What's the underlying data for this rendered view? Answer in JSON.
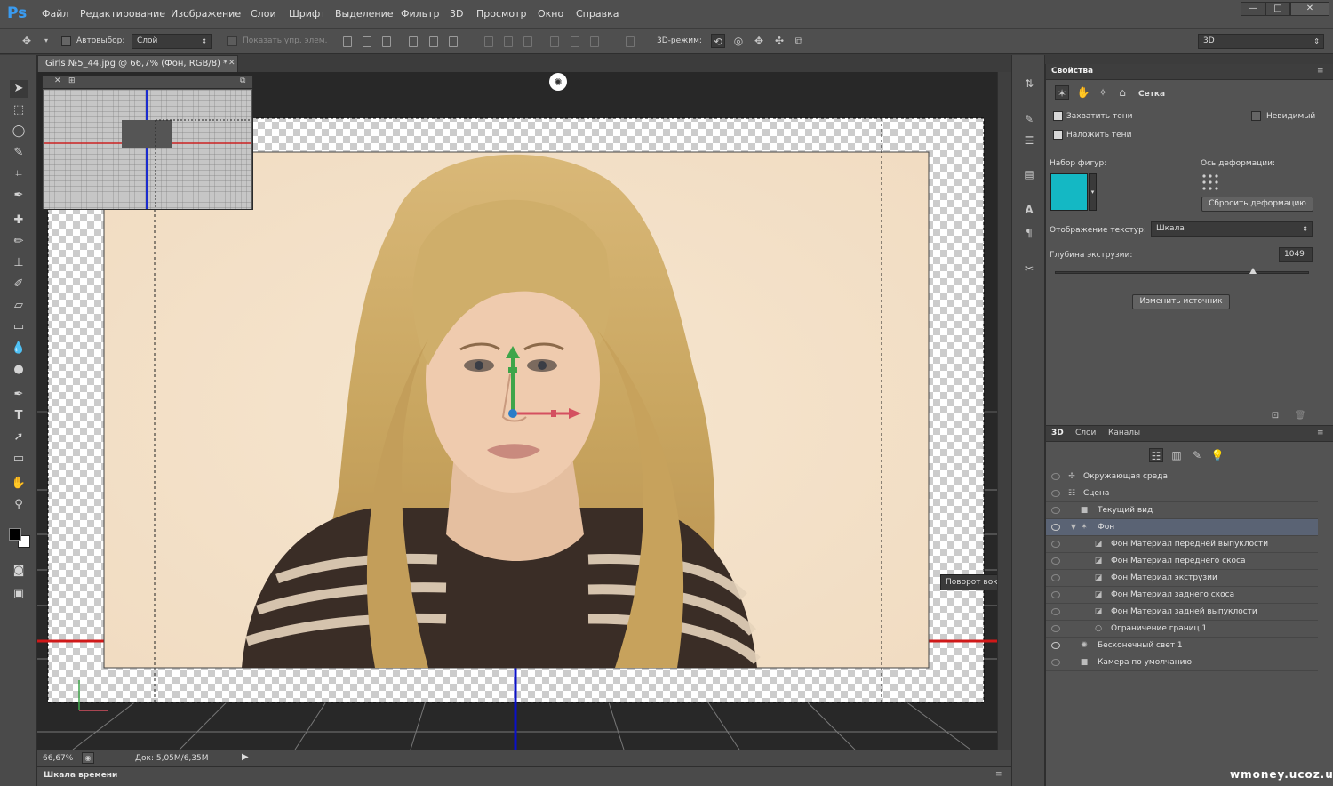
{
  "app": {
    "logo": "Ps"
  },
  "menu": [
    "Файл",
    "Редактирование",
    "Изображение",
    "Слои",
    "Шрифт",
    "Выделение",
    "Фильтр",
    "3D",
    "Просмотр",
    "Окно",
    "Справка"
  ],
  "window_controls": {
    "minimize": "—",
    "maximize": "□",
    "close": "✕"
  },
  "options": {
    "autoselect_label": "Автовыбор:",
    "layer_select": "Слой",
    "show_controls_label": "Показать упр. элем.",
    "mode3d_label": "3D-режим:",
    "workspace_select": "3D"
  },
  "document": {
    "tab_title": "Girls №5_44.jpg @ 66,7% (Фон, RGB/8) *",
    "zoom": "66,67%",
    "doc_size": "Док: 5,05M/6,35M",
    "tooltip": "Поворот вокруг оси Y"
  },
  "timeline": {
    "label": "Шкала времени"
  },
  "properties": {
    "tab": "Свойства",
    "mode_label": "Сетка",
    "capture_shadows": "Захватить тени",
    "cast_shadows": "Наложить тени",
    "invisible": "Невидимый",
    "shape_preset_label": "Набор фигур:",
    "shape_color": "#14b8c4",
    "deform_axis_label": "Ось деформации:",
    "reset_deform_button": "Сбросить деформацию",
    "texture_mapping_label": "Отображение текстур:",
    "texture_mapping_value": "Шкала",
    "extrusion_depth_label": "Глубина экструзии:",
    "extrusion_depth_value": "1049",
    "extrusion_slider_fraction": 0.78,
    "edit_source_button": "Изменить источник"
  },
  "layers_panel": {
    "tabs": [
      "3D",
      "Слои",
      "Каналы"
    ],
    "rows": [
      {
        "label": "Окружающая среда",
        "icon": "environment-icon"
      },
      {
        "label": "Сцена",
        "icon": "scene-icon"
      },
      {
        "label": "Текущий вид",
        "icon": "camera-icon"
      },
      {
        "label": "Фон",
        "icon": "mesh-icon"
      },
      {
        "label": "Фон Материал передней выпуклости",
        "icon": "material-icon"
      },
      {
        "label": "Фон Материал переднего скоса",
        "icon": "material-icon"
      },
      {
        "label": "Фон Материал экструзии",
        "icon": "material-icon"
      },
      {
        "label": "Фон Материал заднего скоса",
        "icon": "material-icon"
      },
      {
        "label": "Фон Материал задней выпуклости",
        "icon": "material-icon"
      },
      {
        "label": "Ограничение границ 1",
        "icon": "constraint-icon"
      },
      {
        "label": "Бесконечный свет 1",
        "icon": "light-icon"
      },
      {
        "label": "Камера по умолчанию",
        "icon": "camera-icon"
      }
    ]
  },
  "watermark": "wmoney.ucoz.ua"
}
